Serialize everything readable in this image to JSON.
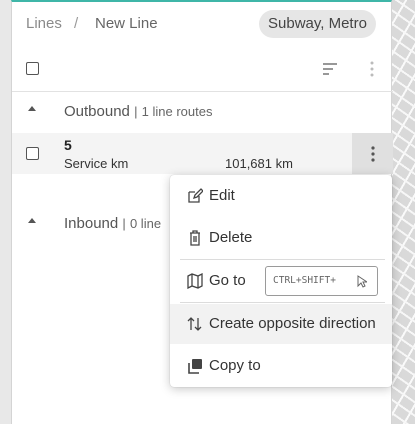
{
  "breadcrumb": {
    "root": "Lines",
    "separator": "/",
    "current": "New Line"
  },
  "mode_chip": "Subway, Metro",
  "sections": {
    "outbound": {
      "title": "Outbound",
      "separator": "|",
      "count": "1 line routes"
    },
    "inbound": {
      "title": "Inbound",
      "separator": "|",
      "count": "0 line"
    }
  },
  "route_row": {
    "name": "5",
    "metric_label": "Service km",
    "metric_value": "101,681 km"
  },
  "context_menu": {
    "edit": "Edit",
    "delete": "Delete",
    "goto": "Go to",
    "goto_shortcut": "CTRL+SHIFT+",
    "create_opposite": "Create opposite direction",
    "copy_to": "Copy to"
  },
  "colors": {
    "accent": "#3fb6a8",
    "row_bg": "#f4f4f4",
    "menu_hover": "#f2f2f2"
  },
  "icons": [
    "filter-sort-icon",
    "more-vert-icon",
    "caret-up-icon",
    "edit-icon",
    "trash-icon",
    "map-icon",
    "cursor-icon",
    "swap-vert-icon",
    "copy-icon"
  ]
}
